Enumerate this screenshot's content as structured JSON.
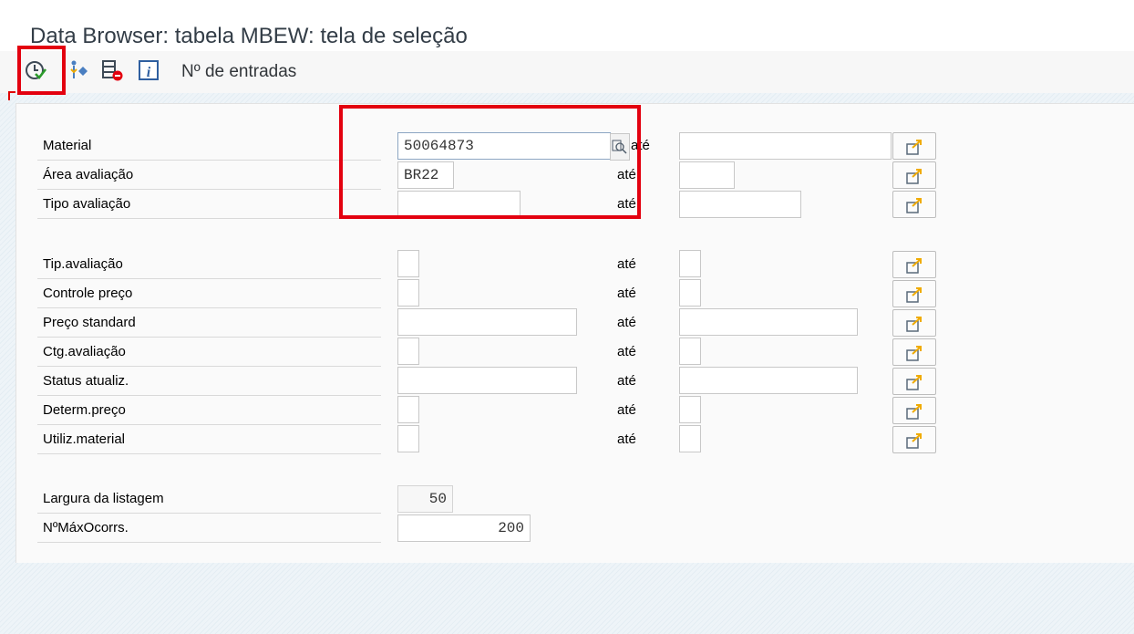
{
  "window": {
    "title": "Data Browser: tabela MBEW: tela de seleção"
  },
  "toolbar": {
    "execute_icon": "execute-clock-check-icon",
    "hierarchy_icon": "hierarchy-diamond-icon",
    "delete_selection_icon": "delete-selection-icon",
    "info_icon": "info-icon",
    "entries_label": "Nº de entradas"
  },
  "fields": [
    {
      "label": "Material",
      "from": "50064873",
      "to_label": "até"
    },
    {
      "label": "Área avaliação",
      "from": "BR22",
      "to_label": "até"
    },
    {
      "label": "Tipo avaliação",
      "from": "",
      "to_label": "até"
    },
    {
      "label": "Tip.avaliação",
      "from": "",
      "to_label": "até"
    },
    {
      "label": "Controle preço",
      "from": "",
      "to_label": "até"
    },
    {
      "label": "Preço standard",
      "from": "",
      "to_label": "até"
    },
    {
      "label": "Ctg.avaliação",
      "from": "",
      "to_label": "até"
    },
    {
      "label": "Status atualiz.",
      "from": "",
      "to_label": "até"
    },
    {
      "label": "Determ.preço",
      "from": "",
      "to_label": "até"
    },
    {
      "label": "Utiliz.material",
      "from": "",
      "to_label": "até"
    }
  ],
  "settings": {
    "list_width_label": "Largura da listagem",
    "list_width_value": "50",
    "max_hits_label": "NºMáxOcorrs.",
    "max_hits_value": "200"
  },
  "colors": {
    "highlight": "#e3000f",
    "accent": "#f0ab00"
  }
}
